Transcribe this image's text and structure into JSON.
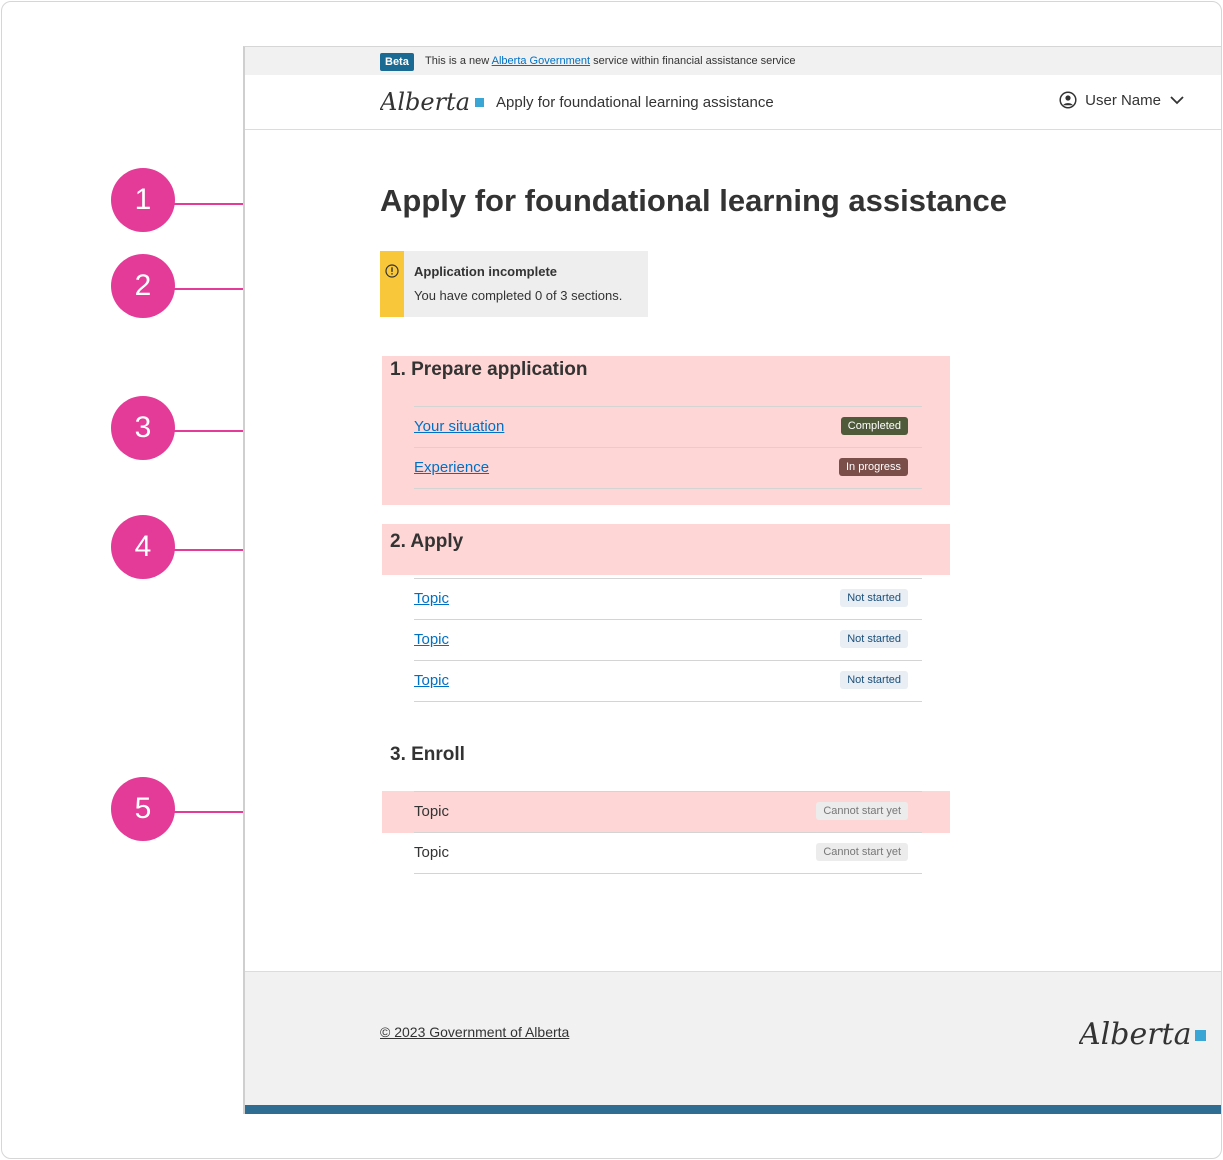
{
  "beta_bar": {
    "badge": "Beta",
    "text_before": "This is a new ",
    "link_text": "Alberta Government",
    "text_after": " service within financial assistance service"
  },
  "header": {
    "logo_text": "Alberta",
    "service_name": "Apply for foundational learning assistance",
    "user_name": "User Name"
  },
  "page": {
    "title": "Apply for foundational learning assistance"
  },
  "callout": {
    "title": "Application incomplete",
    "body": "You have completed 0 of 3 sections."
  },
  "sections": [
    {
      "heading": "1. Prepare application",
      "tasks": [
        {
          "label": "Your situation",
          "status": "Completed"
        },
        {
          "label": "Experience",
          "status": "In progress"
        }
      ]
    },
    {
      "heading": "2. Apply",
      "tasks": [
        {
          "label": "Topic",
          "status": "Not started"
        },
        {
          "label": "Topic",
          "status": "Not started"
        },
        {
          "label": "Topic",
          "status": "Not started"
        }
      ]
    },
    {
      "heading": "3. Enroll",
      "tasks": [
        {
          "label": "Topic",
          "status": "Cannot start yet"
        },
        {
          "label": "Topic",
          "status": "Cannot start yet"
        }
      ]
    }
  ],
  "footer": {
    "copyright": "© 2023 Government of Alberta",
    "logo_text": "Alberta"
  },
  "annotations": [
    "1",
    "2",
    "3",
    "4",
    "5"
  ],
  "colors": {
    "marker": "#e43a98",
    "highlight": "#ffd6d6",
    "callout_accent": "#f9c73a",
    "link": "#0070c4",
    "badge_completed": "#4e5a3a",
    "badge_in_progress": "#7a4f4a",
    "badge_not_started": "#e8eef4",
    "badge_cannot_start": "#ececec"
  }
}
